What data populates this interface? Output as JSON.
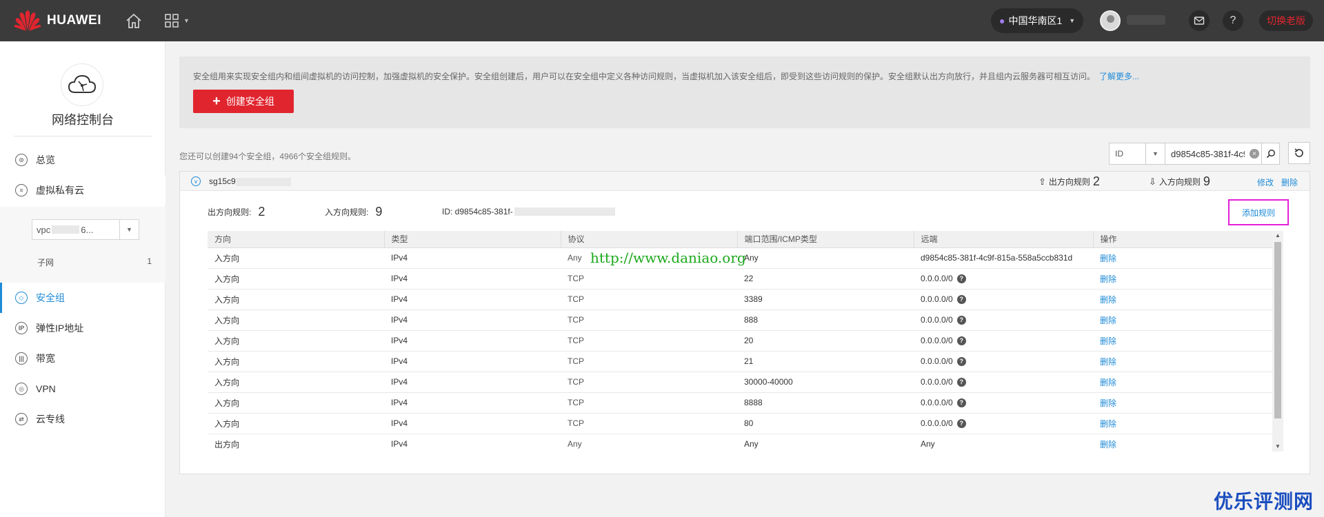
{
  "header": {
    "brand": "HUAWEI",
    "region": "中国华南区1",
    "switch_old_label": "切换老版",
    "icons": {
      "home": "home-icon",
      "apps": "grid-icon",
      "mail": "mail-icon",
      "help": "help-icon",
      "location": "location-pin-icon"
    },
    "accent": "#e1252f"
  },
  "sidebar": {
    "console_title": "网络控制台",
    "items": [
      {
        "label": "总览",
        "icon": "overview-icon"
      },
      {
        "label": "虚拟私有云",
        "icon": "vpc-icon"
      },
      {
        "label": "安全组",
        "icon": "security-group-icon",
        "active": true
      },
      {
        "label": "弹性IP地址",
        "icon": "eip-icon"
      },
      {
        "label": "带宽",
        "icon": "bandwidth-icon"
      },
      {
        "label": "VPN",
        "icon": "vpn-icon"
      },
      {
        "label": "云专线",
        "icon": "direct-connect-icon"
      }
    ],
    "vpc_prefix": "vpc",
    "vpc_suffix": "6...",
    "subnet_label": "子网",
    "subnet_count": "1",
    "active_color": "#1f8bd8"
  },
  "main": {
    "info_text": "安全组用来实现安全组内和组间虚拟机的访问控制，加强虚拟机的安全保护。安全组创建后，用户可以在安全组中定义各种访问规则，当虚拟机加入该安全组后，即受到这些访问规则的保护。安全组默认出方向放行，并且组内云服务器可相互访问。",
    "learn_more": "了解更多...",
    "create_button": "创建安全组",
    "quota_text": "您还可以创建94个安全组，4966个安全组规则。",
    "search": {
      "type": "ID",
      "value": "d9854c85-381f-4c9"
    },
    "group": {
      "name_prefix": "sg15c9",
      "outbound_label": "出方向规则",
      "outbound_count": "2",
      "inbound_label": "入方向规则",
      "inbound_count": "9",
      "edit": "修改",
      "delete": "删除",
      "stats_outbound_label": "出方向规则:",
      "stats_inbound_label": "入方向规则:",
      "id_label": "ID: d9854c85-381f-",
      "add_rule": "添加规则"
    },
    "table": {
      "columns": [
        "方向",
        "类型",
        "协议",
        "端口范围/ICMP类型",
        "远端",
        "操作"
      ],
      "rows": [
        [
          "入方向",
          "IPv4",
          "Any",
          "Any",
          "d9854c85-381f-4c9f-815a-558a5ccb831d",
          "删除"
        ],
        [
          "入方向",
          "IPv4",
          "TCP",
          "22",
          "0.0.0.0/0",
          "删除"
        ],
        [
          "入方向",
          "IPv4",
          "TCP",
          "3389",
          "0.0.0.0/0",
          "删除"
        ],
        [
          "入方向",
          "IPv4",
          "TCP",
          "888",
          "0.0.0.0/0",
          "删除"
        ],
        [
          "入方向",
          "IPv4",
          "TCP",
          "20",
          "0.0.0.0/0",
          "删除"
        ],
        [
          "入方向",
          "IPv4",
          "TCP",
          "21",
          "0.0.0.0/0",
          "删除"
        ],
        [
          "入方向",
          "IPv4",
          "TCP",
          "30000-40000",
          "0.0.0.0/0",
          "删除"
        ],
        [
          "入方向",
          "IPv4",
          "TCP",
          "8888",
          "0.0.0.0/0",
          "删除"
        ],
        [
          "入方向",
          "IPv4",
          "TCP",
          "80",
          "0.0.0.0/0",
          "删除"
        ],
        [
          "出方向",
          "IPv4",
          "Any",
          "Any",
          "Any",
          "删除"
        ]
      ]
    }
  },
  "watermarks": {
    "url": "http://www.daniao.org",
    "site": "优乐评测网"
  }
}
